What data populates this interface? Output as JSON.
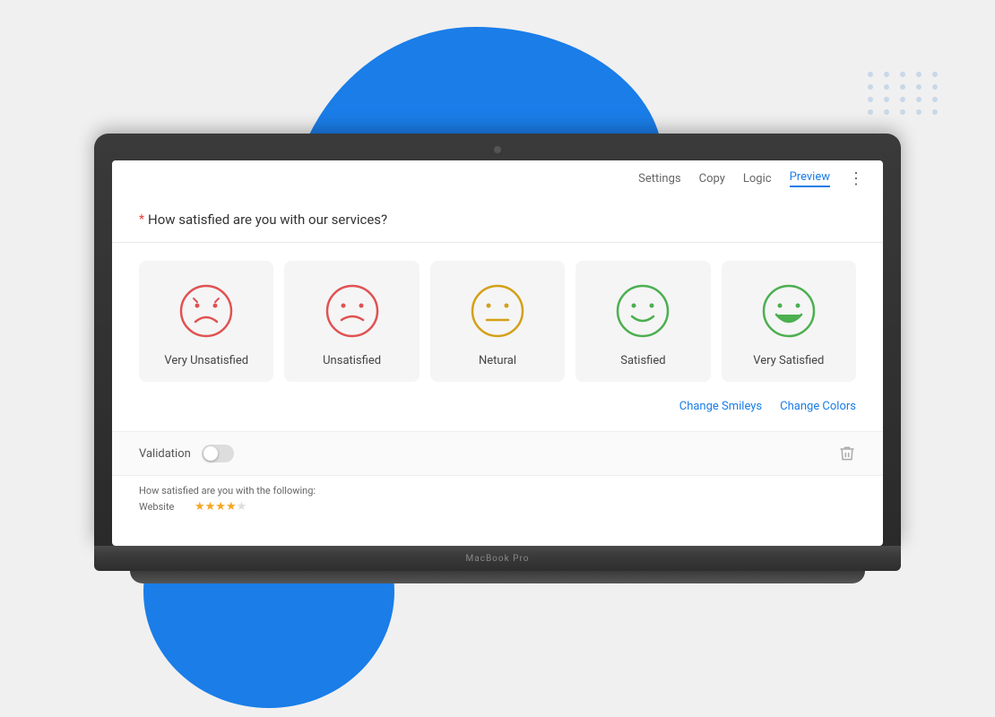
{
  "background": {
    "blob_color": "#1a7de8"
  },
  "toolbar": {
    "items": [
      {
        "label": "Settings",
        "id": "settings",
        "active": false
      },
      {
        "label": "Copy",
        "id": "copy",
        "active": false
      },
      {
        "label": "Logic",
        "id": "logic",
        "active": false
      },
      {
        "label": "Preview",
        "id": "preview",
        "active": true
      }
    ],
    "dots_label": "⋮"
  },
  "question": {
    "required": true,
    "text": "How satisfied are you with our services?"
  },
  "smiley_cards": [
    {
      "label": "Very Unsatisfied",
      "color": "#e05252",
      "type": "very-unhappy"
    },
    {
      "label": "Unsatisfied",
      "color": "#e05252",
      "type": "unhappy"
    },
    {
      "label": "Netural",
      "color": "#d4a017",
      "type": "neutral"
    },
    {
      "label": "Satisfied",
      "color": "#4caf50",
      "type": "happy"
    },
    {
      "label": "Very Satisfied",
      "color": "#4caf50",
      "type": "very-happy"
    }
  ],
  "action_links": {
    "change_smileys": "Change Smileys",
    "change_colors": "Change Colors"
  },
  "validation": {
    "label": "Validation"
  },
  "preview_strip": {
    "question": "How satisfied are you with the following:",
    "website_label": "Website",
    "stars": 4,
    "max_stars": 5
  },
  "laptop": {
    "brand": "MacBook Pro"
  }
}
